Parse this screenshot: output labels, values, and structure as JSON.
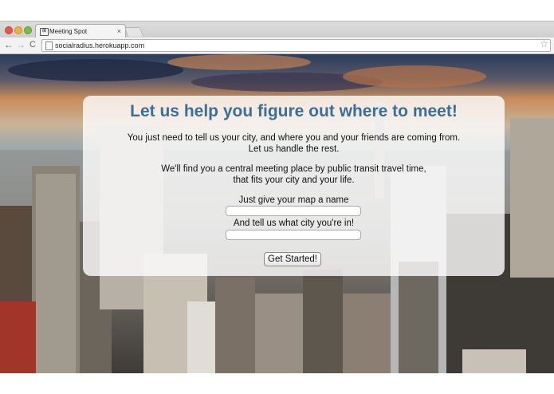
{
  "browser": {
    "tab_title": "Meeting Spot",
    "tab_close": "×",
    "url": "socialradius.herokuapp.com",
    "nav": {
      "back": "←",
      "forward": "→",
      "reload": "C"
    },
    "star": "☆",
    "favicon": "⊞"
  },
  "main": {
    "heading": "Let us help you figure out where to meet!",
    "intro_line1": "You just need to tell us your city, and where you and your friends are coming from.",
    "intro_line2": "Let us handle the rest.",
    "detail_line1": "We'll find you a central meeting place by public transit travel time,",
    "detail_line2": "that fits your city and your life.",
    "map_name_label": "Just give your map a name",
    "map_name_value": "",
    "city_label": "And tell us what city you're in!",
    "city_value": "",
    "submit_label": "Get Started!"
  },
  "colors": {
    "heading": "#3d6f96",
    "card_bg": "rgba(255,255,255,0.80)"
  }
}
